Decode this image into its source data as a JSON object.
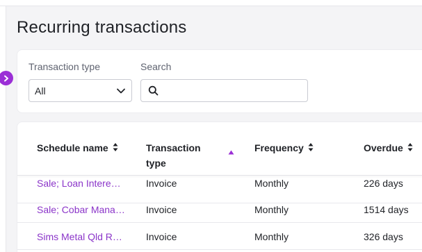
{
  "page": {
    "title": "Recurring transactions"
  },
  "filters": {
    "transaction_type_label": "Transaction type",
    "transaction_type_value": "All",
    "search_label": "Search",
    "search_value": ""
  },
  "table": {
    "headers": {
      "schedule_name": "Schedule name",
      "transaction_type": "Transaction type",
      "frequency": "Frequency",
      "overdue": "Overdue"
    },
    "rows": [
      {
        "schedule_name": "Sale; Loan Intere…",
        "transaction_type": "Invoice",
        "frequency": "Monthly",
        "overdue": "226 days"
      },
      {
        "schedule_name": "Sale; Cobar Mana…",
        "transaction_type": "Invoice",
        "frequency": "Monthly",
        "overdue": "1514 days"
      },
      {
        "schedule_name": "Sims Metal Qld R…",
        "transaction_type": "Invoice",
        "frequency": "Monthly",
        "overdue": "326 days"
      }
    ]
  },
  "colors": {
    "accent": "#9b2fd6",
    "link": "#8b35c9"
  }
}
